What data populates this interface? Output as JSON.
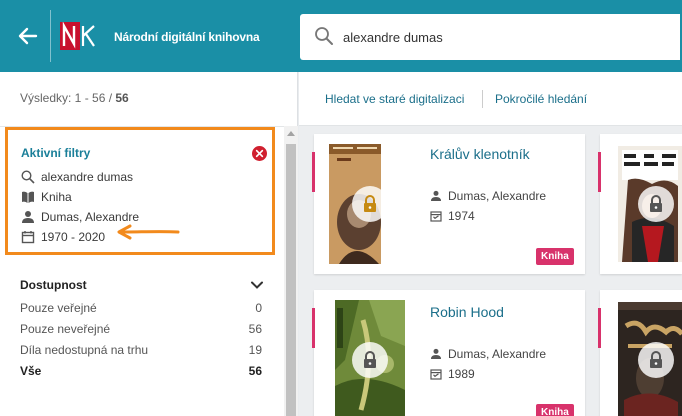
{
  "header": {
    "app_title": "Národní digitální knihovna",
    "search_value": "alexandre dumas"
  },
  "results": {
    "label": "Výsledky: 1 - 56 / ",
    "total": "56"
  },
  "active_filters": {
    "title": "Aktivní filtry",
    "items": [
      {
        "icon": "search-icon",
        "text": "alexandre dumas"
      },
      {
        "icon": "book-icon",
        "text": "Kniha"
      },
      {
        "icon": "person-icon",
        "text": "Dumas, Alexandre"
      },
      {
        "icon": "calendar-icon",
        "text": "1970 - 2020"
      }
    ]
  },
  "availability": {
    "title": "Dostupnost",
    "items": [
      {
        "label": "Pouze veřejné",
        "count": "0"
      },
      {
        "label": "Pouze neveřejné",
        "count": "56"
      },
      {
        "label": "Díla nedostupná na trhu",
        "count": "19"
      },
      {
        "label": "Vše",
        "count": "56"
      }
    ]
  },
  "toolbar": {
    "old_digitization": "Hledat ve staré digitalizaci",
    "advanced_search": "Pokročilé hledání"
  },
  "cards": [
    {
      "title": "Králův klenotník",
      "author": "Dumas, Alexandre",
      "year": "1974",
      "badge": "Kniha"
    },
    {
      "title": "Robin Hood",
      "author": "Dumas, Alexandre",
      "year": "1989",
      "badge": "Kniha"
    }
  ],
  "colors": {
    "header": "#1a8fa6",
    "link": "#1b6f8a",
    "badge": "#d8326b",
    "highlight": "#f28a1c"
  }
}
